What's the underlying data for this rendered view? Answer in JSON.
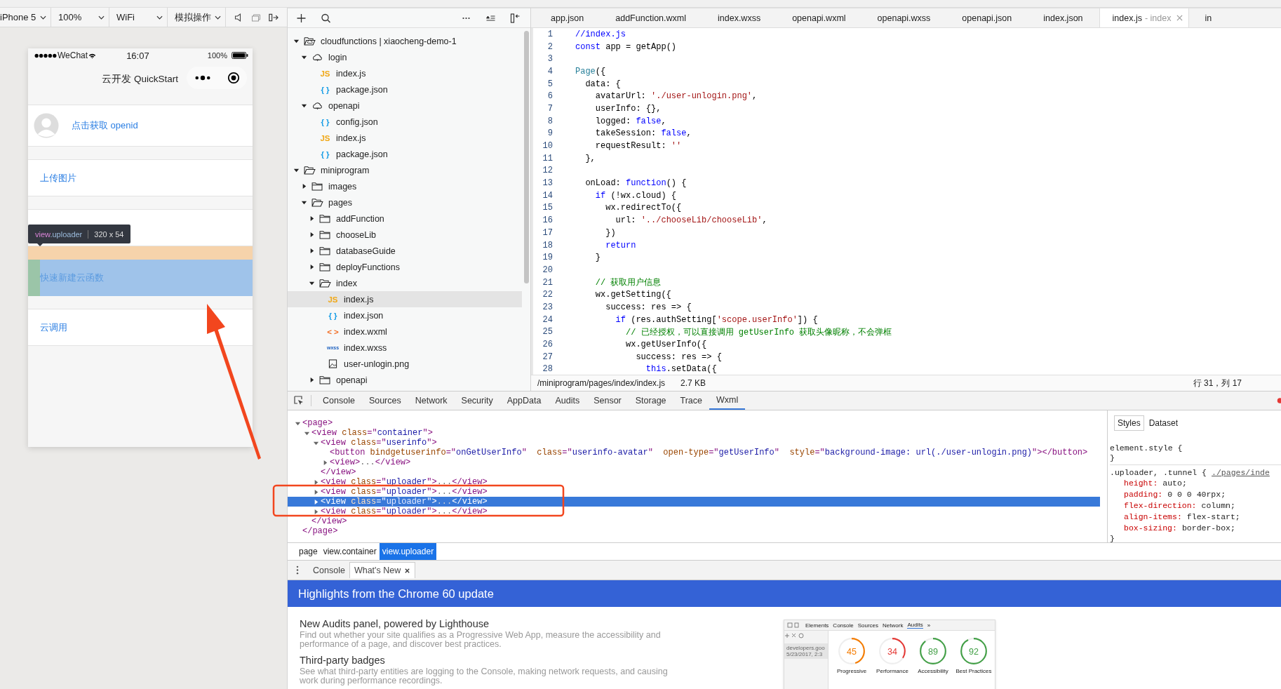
{
  "toolbar": {
    "dropdowns": [
      {
        "label": "iPhone 5"
      },
      {
        "label": "100%"
      },
      {
        "label": "WiFi"
      },
      {
        "label": "模拟操作"
      }
    ]
  },
  "simulator": {
    "status_bar": {
      "carrier": "WeChat",
      "time": "16:07",
      "battery": "100%"
    },
    "nav_title": "云开发 QuickStart",
    "items": [
      {
        "kind": "avatar",
        "label": "点击获取 openid"
      },
      {
        "kind": "link",
        "label": "上传图片"
      },
      {
        "kind": "covered"
      },
      {
        "kind": "highlighted",
        "label": "快速新建云函数"
      },
      {
        "kind": "link",
        "label": "云调用"
      }
    ],
    "tooltip": {
      "tag": "view",
      "class_name": ".uploader",
      "size": "320 x 54"
    }
  },
  "file_tree": {
    "items": [
      {
        "name": "cloudfunctions | xiaocheng-demo-1",
        "kind": "cloud-root",
        "expanded": true,
        "selected": false,
        "children": [
          {
            "name": "login",
            "kind": "cloud",
            "expanded": true,
            "selected": false,
            "children": [
              {
                "name": "index.js",
                "kind": "js",
                "badge": "JS",
                "selected": false
              },
              {
                "name": "package.json",
                "kind": "json",
                "badge": "{ }",
                "selected": false
              }
            ]
          },
          {
            "name": "openapi",
            "kind": "cloud",
            "expanded": true,
            "selected": false,
            "children": [
              {
                "name": "config.json",
                "kind": "json",
                "badge": "{ }",
                "selected": false
              },
              {
                "name": "index.js",
                "kind": "js",
                "badge": "JS",
                "selected": false
              },
              {
                "name": "package.json",
                "kind": "json",
                "badge": "{ }",
                "selected": false
              }
            ]
          }
        ]
      },
      {
        "name": "miniprogram",
        "kind": "folder",
        "expanded": true,
        "selected": false,
        "children": [
          {
            "name": "images",
            "kind": "folder",
            "expanded": false,
            "selected": false
          },
          {
            "name": "pages",
            "kind": "folder",
            "expanded": true,
            "selected": false,
            "children": [
              {
                "name": "addFunction",
                "kind": "folder",
                "expanded": false,
                "selected": false
              },
              {
                "name": "chooseLib",
                "kind": "folder",
                "expanded": false,
                "selected": false
              },
              {
                "name": "databaseGuide",
                "kind": "folder",
                "expanded": false,
                "selected": false
              },
              {
                "name": "deployFunctions",
                "kind": "folder",
                "expanded": false,
                "selected": false
              },
              {
                "name": "index",
                "kind": "folder",
                "expanded": true,
                "selected": false,
                "children": [
                  {
                    "name": "index.js",
                    "kind": "js",
                    "badge": "JS",
                    "selected": true
                  },
                  {
                    "name": "index.json",
                    "kind": "json",
                    "badge": "{ }",
                    "selected": false
                  },
                  {
                    "name": "index.wxml",
                    "kind": "wxml",
                    "badge": "< >",
                    "selected": false
                  },
                  {
                    "name": "index.wxss",
                    "kind": "wxss",
                    "badge": "wxss",
                    "selected": false
                  },
                  {
                    "name": "user-unlogin.png",
                    "kind": "image",
                    "selected": false
                  }
                ]
              },
              {
                "name": "openapi",
                "kind": "folder",
                "expanded": false,
                "selected": false
              }
            ]
          }
        ]
      }
    ]
  },
  "editor": {
    "tabs": [
      {
        "label": "app.json",
        "selected": false
      },
      {
        "label": "addFunction.wxml",
        "selected": false
      },
      {
        "label": "index.wxss",
        "selected": false
      },
      {
        "label": "openapi.wxml",
        "selected": false
      },
      {
        "label": "openapi.wxss",
        "selected": false
      },
      {
        "label": "openapi.json",
        "selected": false
      },
      {
        "label": "index.json",
        "selected": false
      },
      {
        "label": "index.js",
        "suffix": "- index",
        "selected": true,
        "closable": true
      },
      {
        "label": "in",
        "selected": false
      }
    ],
    "lines": [
      {
        "n": "1",
        "tokens": [
          {
            "text": "//index.js",
            "kind": "keyword"
          }
        ]
      },
      {
        "n": "2",
        "tokens": [
          {
            "text": "const",
            "kind": "keyword"
          },
          {
            "text": " app = getApp()",
            "kind": "plain"
          }
        ]
      },
      {
        "n": "3"
      },
      {
        "n": "4",
        "tokens": [
          {
            "text": "Page",
            "kind": "type"
          },
          {
            "text": "({",
            "kind": "plain"
          }
        ]
      },
      {
        "n": "5",
        "tokens": [
          {
            "text": "  data: {",
            "kind": "plain"
          }
        ]
      },
      {
        "n": "6",
        "tokens": [
          {
            "text": "    avatarUrl: ",
            "kind": "plain"
          },
          {
            "text": "'./user-unlogin.png'",
            "kind": "string"
          },
          {
            "text": ",",
            "kind": "plain"
          }
        ]
      },
      {
        "n": "7",
        "tokens": [
          {
            "text": "    userInfo: {},",
            "kind": "plain"
          }
        ]
      },
      {
        "n": "8",
        "tokens": [
          {
            "text": "    logged: ",
            "kind": "plain"
          },
          {
            "text": "false",
            "kind": "keyword"
          },
          {
            "text": ",",
            "kind": "plain"
          }
        ]
      },
      {
        "n": "9",
        "tokens": [
          {
            "text": "    takeSession: ",
            "kind": "plain"
          },
          {
            "text": "false",
            "kind": "keyword"
          },
          {
            "text": ",",
            "kind": "plain"
          }
        ]
      },
      {
        "n": "10",
        "tokens": [
          {
            "text": "    requestResult: ",
            "kind": "plain"
          },
          {
            "text": "''",
            "kind": "string"
          }
        ]
      },
      {
        "n": "11",
        "tokens": [
          {
            "text": "  },",
            "kind": "plain"
          }
        ]
      },
      {
        "n": "12"
      },
      {
        "n": "13",
        "tokens": [
          {
            "text": "  onLoad: ",
            "kind": "plain"
          },
          {
            "text": "function",
            "kind": "keyword"
          },
          {
            "text": "() {",
            "kind": "plain"
          }
        ]
      },
      {
        "n": "14",
        "tokens": [
          {
            "text": "    if",
            "kind": "keyword"
          },
          {
            "text": " (!wx.cloud) {",
            "kind": "plain"
          }
        ]
      },
      {
        "n": "15",
        "tokens": [
          {
            "text": "      wx.redirectTo({",
            "kind": "plain"
          }
        ]
      },
      {
        "n": "16",
        "tokens": [
          {
            "text": "        url: ",
            "kind": "plain"
          },
          {
            "text": "'../chooseLib/chooseLib'",
            "kind": "string"
          },
          {
            "text": ",",
            "kind": "plain"
          }
        ]
      },
      {
        "n": "17",
        "tokens": [
          {
            "text": "      })",
            "kind": "plain"
          }
        ]
      },
      {
        "n": "18",
        "tokens": [
          {
            "text": "      return",
            "kind": "keyword"
          }
        ]
      },
      {
        "n": "19",
        "tokens": [
          {
            "text": "    }",
            "kind": "plain"
          }
        ]
      },
      {
        "n": "20"
      },
      {
        "n": "21",
        "tokens": [
          {
            "text": "    // 获取用户信息",
            "kind": "comment"
          }
        ]
      },
      {
        "n": "22",
        "tokens": [
          {
            "text": "    wx.getSetting({",
            "kind": "plain"
          }
        ]
      },
      {
        "n": "23",
        "tokens": [
          {
            "text": "      success: res => {",
            "kind": "plain"
          }
        ]
      },
      {
        "n": "24",
        "tokens": [
          {
            "text": "        if",
            "kind": "keyword"
          },
          {
            "text": " (res.authSetting[",
            "kind": "plain"
          },
          {
            "text": "'scope.userInfo'",
            "kind": "string"
          },
          {
            "text": "]) {",
            "kind": "plain"
          }
        ]
      },
      {
        "n": "25",
        "tokens": [
          {
            "text": "          // 已经授权，可以直接调用 getUserInfo 获取头像昵称，不会弹框",
            "kind": "comment"
          }
        ]
      },
      {
        "n": "26",
        "tokens": [
          {
            "text": "          wx.getUserInfo({",
            "kind": "plain"
          }
        ]
      },
      {
        "n": "27",
        "tokens": [
          {
            "text": "            success: res => {",
            "kind": "plain"
          }
        ]
      },
      {
        "n": "28",
        "tokens": [
          {
            "text": "              this",
            "kind": "keyword"
          },
          {
            "text": ".setData({",
            "kind": "plain"
          }
        ]
      }
    ],
    "status": {
      "path": "/miniprogram/pages/index/index.js",
      "size": "2.7 KB",
      "cursor": "行 31，列 17"
    }
  },
  "devtools": {
    "tabs": [
      {
        "label": "Console",
        "selected": false
      },
      {
        "label": "Sources",
        "selected": false
      },
      {
        "label": "Network",
        "selected": false
      },
      {
        "label": "Security",
        "selected": false
      },
      {
        "label": "AppData",
        "selected": false
      },
      {
        "label": "Audits",
        "selected": false
      },
      {
        "label": "Sensor",
        "selected": false
      },
      {
        "label": "Storage",
        "selected": false
      },
      {
        "label": "Trace",
        "selected": false
      },
      {
        "label": "Wxml",
        "selected": true
      }
    ],
    "wxml": {
      "open": [
        {
          "text": "<page>",
          "kind": "tag"
        }
      ],
      "close": [
        {
          "text": "</page>",
          "kind": "tag"
        }
      ],
      "expanded": true,
      "selected": false,
      "children": [
        {
          "open": [
            {
              "text": "<view",
              "kind": "tag"
            },
            {
              "text": " class",
              "kind": "attr"
            },
            {
              "text": "=\"",
              "kind": "tag"
            },
            {
              "text": "container",
              "kind": "value"
            },
            {
              "text": "\">",
              "kind": "tag"
            }
          ],
          "close": [
            {
              "text": "</view>",
              "kind": "tag"
            }
          ],
          "expanded": true,
          "selected": false,
          "children": [
            {
              "open": [
                {
                  "text": "<view",
                  "kind": "tag"
                },
                {
                  "text": " class",
                  "kind": "attr"
                },
                {
                  "text": "=\"",
                  "kind": "tag"
                },
                {
                  "text": "userinfo",
                  "kind": "value"
                },
                {
                  "text": "\">",
                  "kind": "tag"
                }
              ],
              "close": [
                {
                  "text": "</view>",
                  "kind": "tag"
                }
              ],
              "expanded": true,
              "selected": false,
              "children": [
                {
                  "open": [
                    {
                      "text": "<button",
                      "kind": "tag"
                    },
                    {
                      "text": " bindgetuserinfo",
                      "kind": "attr"
                    },
                    {
                      "text": "=\"",
                      "kind": "tag"
                    },
                    {
                      "text": "onGetUserInfo",
                      "kind": "value"
                    },
                    {
                      "text": "\"",
                      "kind": "tag"
                    },
                    {
                      "text": "  class",
                      "kind": "attr"
                    },
                    {
                      "text": "=\"",
                      "kind": "tag"
                    },
                    {
                      "text": "userinfo-avatar",
                      "kind": "value"
                    },
                    {
                      "text": "\"",
                      "kind": "tag"
                    },
                    {
                      "text": "  open-type",
                      "kind": "attr"
                    },
                    {
                      "text": "=\"",
                      "kind": "tag"
                    },
                    {
                      "text": "getUserInfo",
                      "kind": "value"
                    },
                    {
                      "text": "\"",
                      "kind": "tag"
                    },
                    {
                      "text": "  style",
                      "kind": "attr"
                    },
                    {
                      "text": "=\"",
                      "kind": "tag"
                    },
                    {
                      "text": "background-image: url(./user-unlogin.png)",
                      "kind": "value"
                    },
                    {
                      "text": "\"></button>",
                      "kind": "tag"
                    }
                  ],
                  "selected": false
                },
                {
                  "open": [
                    {
                      "text": "<view>",
                      "kind": "tag"
                    },
                    {
                      "text": "...",
                      "kind": "dim"
                    },
                    {
                      "text": "</view>",
                      "kind": "tag"
                    }
                  ],
                  "expanded": false,
                  "selected": false
                }
              ]
            },
            {
              "open": [
                {
                  "text": "<view",
                  "kind": "tag"
                },
                {
                  "text": " class",
                  "kind": "attr"
                },
                {
                  "text": "=\"",
                  "kind": "tag"
                },
                {
                  "text": "uploader",
                  "kind": "value"
                },
                {
                  "text": "\">",
                  "kind": "tag"
                },
                {
                  "text": "...",
                  "kind": "dim"
                },
                {
                  "text": "</view>",
                  "kind": "tag"
                }
              ],
              "expanded": false,
              "selected": false
            },
            {
              "open": [
                {
                  "text": "<view",
                  "kind": "tag"
                },
                {
                  "text": " class",
                  "kind": "attr"
                },
                {
                  "text": "=\"",
                  "kind": "tag"
                },
                {
                  "text": "uploader",
                  "kind": "value"
                },
                {
                  "text": "\">",
                  "kind": "tag"
                },
                {
                  "text": "...",
                  "kind": "dim"
                },
                {
                  "text": "</view>",
                  "kind": "tag"
                }
              ],
              "expanded": false,
              "selected": false
            },
            {
              "open": [
                {
                  "text": "<view",
                  "kind": "tag"
                },
                {
                  "text": " class",
                  "kind": "attr"
                },
                {
                  "text": "=\"",
                  "kind": "tag"
                },
                {
                  "text": "uploader",
                  "kind": "value"
                },
                {
                  "text": "\">",
                  "kind": "tag"
                },
                {
                  "text": "...",
                  "kind": "dim"
                },
                {
                  "text": "</view>",
                  "kind": "tag"
                }
              ],
              "expanded": false,
              "selected": true
            },
            {
              "open": [
                {
                  "text": "<view",
                  "kind": "tag"
                },
                {
                  "text": " class",
                  "kind": "attr"
                },
                {
                  "text": "=\"",
                  "kind": "tag"
                },
                {
                  "text": "uploader",
                  "kind": "value"
                },
                {
                  "text": "\">",
                  "kind": "tag"
                },
                {
                  "text": "...",
                  "kind": "dim"
                },
                {
                  "text": "</view>",
                  "kind": "tag"
                }
              ],
              "expanded": false,
              "selected": false
            }
          ]
        }
      ]
    },
    "styles": {
      "tabs": [
        {
          "label": "Styles",
          "selected": true
        },
        {
          "label": "Dataset",
          "selected": false
        }
      ],
      "lines": [
        {
          "kind": "selector",
          "text": "element.style {"
        },
        {
          "kind": "brace",
          "text": "}"
        },
        {
          "kind": "selector",
          "text": ".uploader, .tunnel {",
          "link": "./pages/inde",
          "divider": true
        },
        {
          "kind": "property",
          "name": "height:",
          "value": "auto;"
        },
        {
          "kind": "property",
          "name": "padding:",
          "value": "0 0 0 40rpx;"
        },
        {
          "kind": "property",
          "name": "flex-direction:",
          "value": "column;"
        },
        {
          "kind": "property",
          "name": "align-items:",
          "value": "flex-start;"
        },
        {
          "kind": "property",
          "name": "box-sizing:",
          "value": "border-box;"
        },
        {
          "kind": "brace",
          "text": "}"
        }
      ]
    },
    "breadcrumbs": [
      {
        "label": "page",
        "selected": false
      },
      {
        "label": "view.container",
        "selected": false
      },
      {
        "label": "view.uploader",
        "selected": true
      }
    ]
  },
  "drawer": {
    "tabs": [
      {
        "label": "Console",
        "selected": false
      },
      {
        "label": "What's New",
        "selected": true,
        "closable": true
      }
    ],
    "banner": "Highlights from the Chrome 60 update",
    "features": [
      {
        "title": "New Audits panel, powered by Lighthouse",
        "description": "Find out whether your site qualifies as a Progressive Web App, measure the accessibility and performance of a page, and discover best practices."
      },
      {
        "title": "Third-party badges",
        "description": "See what third-party entities are logging to the Console, making network requests, and causing work during performance recordings."
      }
    ],
    "thumbnail": {
      "tabs": [
        {
          "label": "Elements",
          "selected": false
        },
        {
          "label": "Console",
          "selected": false
        },
        {
          "label": "Sources",
          "selected": false
        },
        {
          "label": "Network",
          "selected": false
        },
        {
          "label": "Audits",
          "selected": true
        }
      ],
      "more": "»",
      "report_url": "developers.goo",
      "report_date": "5/23/2017, 2:3",
      "scores": [
        {
          "value": "45",
          "label": "Progressive",
          "color": "#f57c00"
        },
        {
          "value": "34",
          "label": "Performance",
          "color": "#e53935"
        },
        {
          "value": "89",
          "label": "Accessibility",
          "color": "#43a047"
        },
        {
          "value": "92",
          "label": "Best Practices",
          "color": "#43a047"
        }
      ]
    }
  }
}
